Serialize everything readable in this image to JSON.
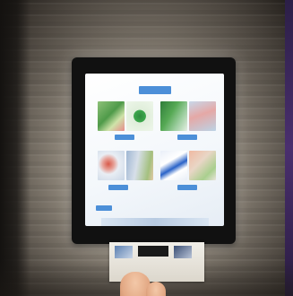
{
  "screen": {
    "header_label": "",
    "tiles": [
      {
        "label": ""
      },
      {
        "label": ""
      },
      {
        "label": ""
      },
      {
        "label": ""
      }
    ],
    "corner_label": ""
  },
  "print": {
    "banner_text": ""
  },
  "colors": {
    "label_blue": "#4c8fd8",
    "frame": "#111111",
    "banner_yellow": "#e7c320",
    "right_stripe": "#3a2659"
  },
  "icons": [
    "phone-frame",
    "finger"
  ]
}
